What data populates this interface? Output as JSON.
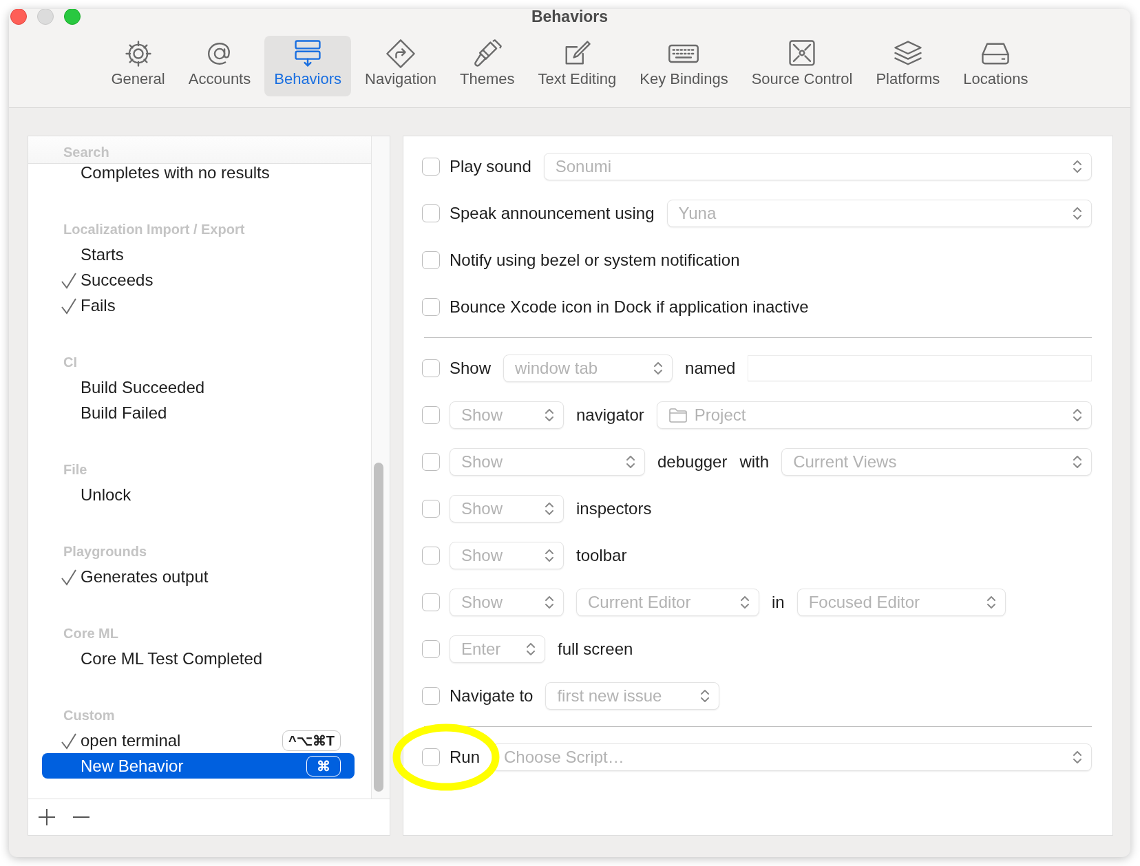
{
  "window": {
    "title": "Behaviors"
  },
  "toolbar": [
    {
      "label": "General",
      "selected": false
    },
    {
      "label": "Accounts",
      "selected": false
    },
    {
      "label": "Behaviors",
      "selected": true
    },
    {
      "label": "Navigation",
      "selected": false
    },
    {
      "label": "Themes",
      "selected": false
    },
    {
      "label": "Text Editing",
      "selected": false
    },
    {
      "label": "Key Bindings",
      "selected": false
    },
    {
      "label": "Source Control",
      "selected": false
    },
    {
      "label": "Platforms",
      "selected": false
    },
    {
      "label": "Locations",
      "selected": false
    }
  ],
  "behaviors_list": {
    "sections": [
      {
        "header": "Search",
        "items": [
          {
            "label": "Completes with no results",
            "checked": false,
            "selected": false
          }
        ]
      },
      {
        "header": "Localization Import / Export",
        "items": [
          {
            "label": "Starts",
            "checked": false,
            "selected": false
          },
          {
            "label": "Succeeds",
            "checked": true,
            "selected": false
          },
          {
            "label": "Fails",
            "checked": true,
            "selected": false
          }
        ]
      },
      {
        "header": "CI",
        "items": [
          {
            "label": "Build Succeeded",
            "checked": false,
            "selected": false
          },
          {
            "label": "Build Failed",
            "checked": false,
            "selected": false
          }
        ]
      },
      {
        "header": "File",
        "items": [
          {
            "label": "Unlock",
            "checked": false,
            "selected": false
          }
        ]
      },
      {
        "header": "Playgrounds",
        "items": [
          {
            "label": "Generates output",
            "checked": true,
            "selected": false
          }
        ]
      },
      {
        "header": "Core ML",
        "items": [
          {
            "label": "Core ML Test Completed",
            "checked": false,
            "selected": false
          }
        ]
      },
      {
        "header": "Custom",
        "items": [
          {
            "label": "open terminal",
            "checked": true,
            "selected": false,
            "shortcut": "^⌥⌘T"
          },
          {
            "label": "New Behavior",
            "checked": false,
            "selected": true,
            "shortcut": "⌘"
          }
        ]
      }
    ]
  },
  "actions": [
    {
      "kind": "option",
      "checked": false,
      "parts": [
        {
          "kind": "label",
          "text": "Play sound"
        },
        {
          "kind": "popup",
          "value": "Sonumi",
          "disabled": true
        }
      ]
    },
    {
      "kind": "option",
      "checked": false,
      "parts": [
        {
          "kind": "label",
          "text": "Speak announcement using"
        },
        {
          "kind": "popup",
          "value": "Yuna",
          "disabled": true
        }
      ]
    },
    {
      "kind": "option",
      "checked": false,
      "parts": [
        {
          "kind": "label",
          "text": "Notify using bezel or system notification"
        }
      ]
    },
    {
      "kind": "option",
      "checked": false,
      "parts": [
        {
          "kind": "label",
          "text": "Bounce Xcode icon in Dock if application inactive"
        }
      ]
    },
    {
      "kind": "separator"
    },
    {
      "kind": "option",
      "checked": false,
      "parts": [
        {
          "kind": "label",
          "text": "Show"
        },
        {
          "kind": "popup",
          "value": "window tab",
          "disabled": true
        },
        {
          "kind": "label",
          "text": "named"
        },
        {
          "kind": "field"
        }
      ]
    },
    {
      "kind": "option",
      "checked": false,
      "parts": [
        {
          "kind": "popup",
          "value": "Show",
          "disabled": true
        },
        {
          "kind": "label",
          "text": "navigator"
        },
        {
          "kind": "popup",
          "value": "Project",
          "disabled": true
        }
      ]
    },
    {
      "kind": "option",
      "checked": false,
      "parts": [
        {
          "kind": "popup",
          "value": "Show",
          "disabled": true
        },
        {
          "kind": "label",
          "text": "debugger"
        },
        {
          "kind": "label",
          "text": "with"
        },
        {
          "kind": "popup",
          "value": "Current Views",
          "disabled": true
        }
      ]
    },
    {
      "kind": "option",
      "checked": false,
      "parts": [
        {
          "kind": "popup",
          "value": "Show",
          "disabled": true
        },
        {
          "kind": "label",
          "text": "inspectors"
        }
      ]
    },
    {
      "kind": "option",
      "checked": false,
      "parts": [
        {
          "kind": "popup",
          "value": "Show",
          "disabled": true
        },
        {
          "kind": "label",
          "text": "toolbar"
        }
      ]
    },
    {
      "kind": "option",
      "checked": false,
      "parts": [
        {
          "kind": "popup",
          "value": "Show",
          "disabled": true
        },
        {
          "kind": "popup",
          "value": "Current Editor",
          "disabled": true
        },
        {
          "kind": "label",
          "text": "in"
        },
        {
          "kind": "popup",
          "value": "Focused Editor",
          "disabled": true
        }
      ]
    },
    {
      "kind": "option",
      "checked": false,
      "parts": [
        {
          "kind": "popup",
          "value": "Enter",
          "disabled": true
        },
        {
          "kind": "label",
          "text": "full screen"
        }
      ]
    },
    {
      "kind": "option",
      "checked": false,
      "parts": [
        {
          "kind": "label",
          "text": "Navigate to"
        },
        {
          "kind": "popup",
          "value": "first new issue",
          "disabled": true
        }
      ]
    },
    {
      "kind": "separator"
    },
    {
      "kind": "option",
      "checked": false,
      "parts": [
        {
          "kind": "label",
          "text": "Run"
        },
        {
          "kind": "popup",
          "value": "Choose Script…",
          "disabled": true
        }
      ]
    }
  ]
}
